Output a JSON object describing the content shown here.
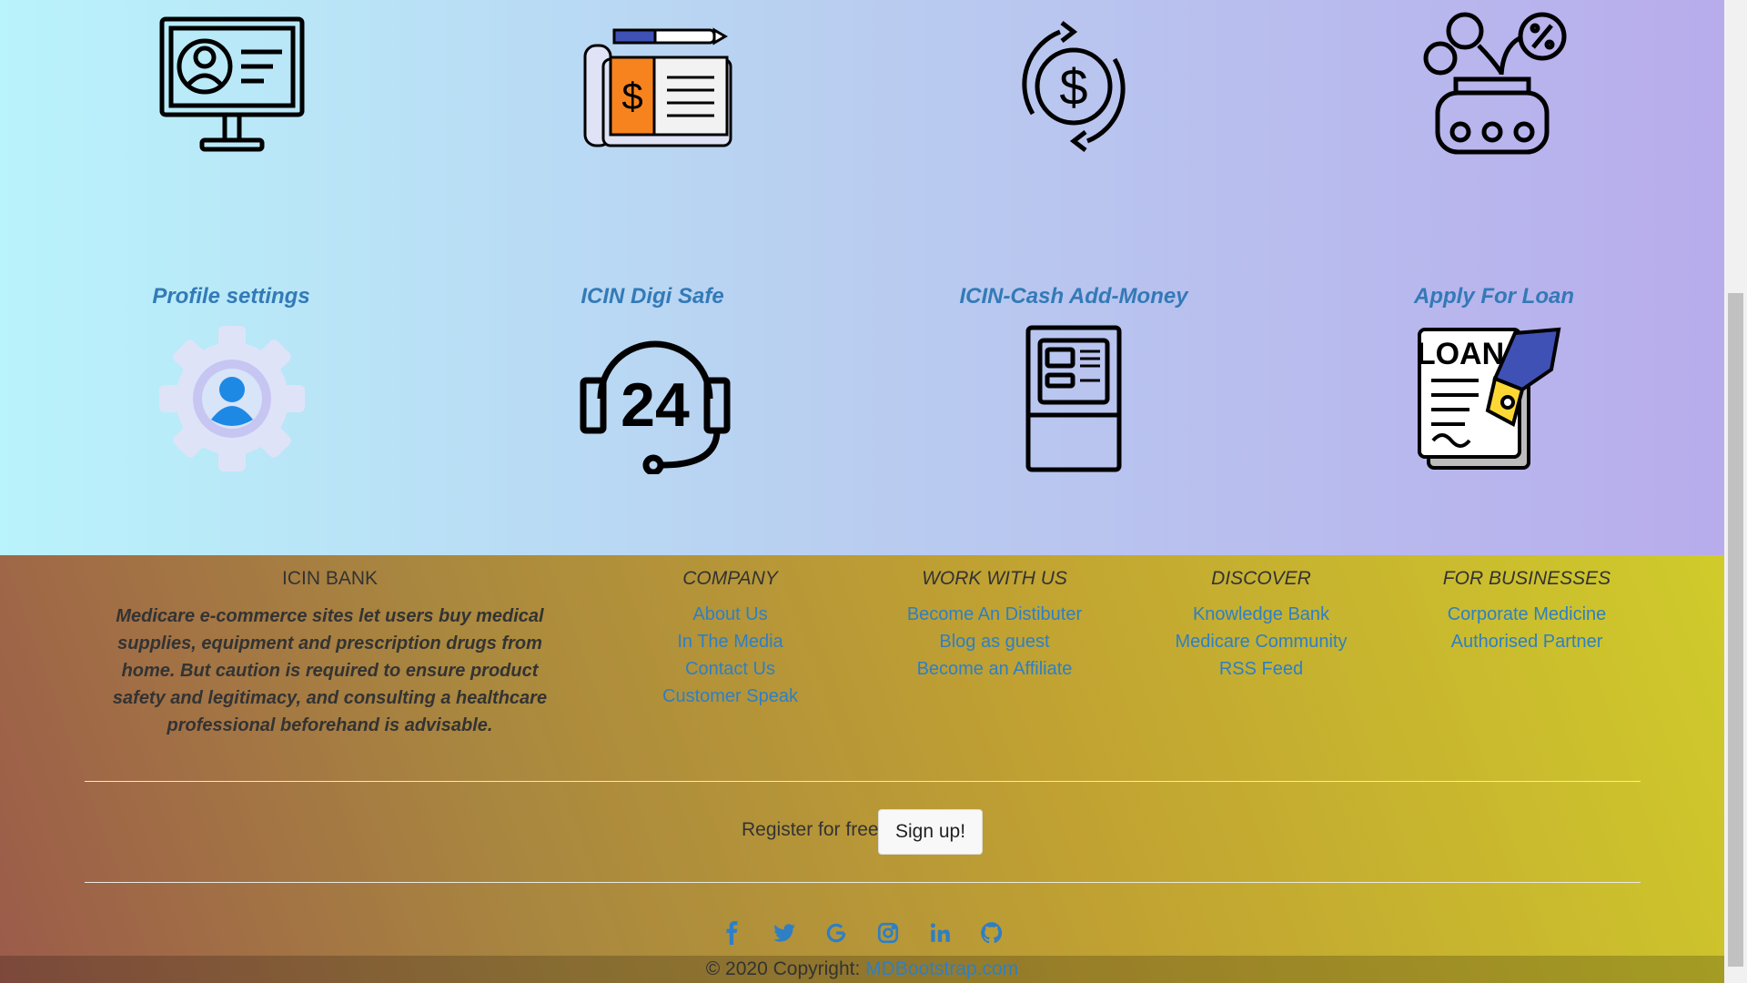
{
  "tiles_row2": [
    {
      "title": "Profile settings",
      "icon": "profile-gear-icon"
    },
    {
      "title": "ICIN Digi Safe",
      "icon": "headset-24-icon"
    },
    {
      "title": "ICIN-Cash Add-Money",
      "icon": "atm-icon"
    },
    {
      "title": "Apply For Loan",
      "icon": "loan-document-icon"
    }
  ],
  "tiles_row1_icons": [
    "monitor-profile-icon",
    "newspaper-dollar-icon",
    "dollar-exchange-icon",
    "loan-machine-icon"
  ],
  "footer": {
    "brand": "ICIN BANK",
    "description": "Medicare e-commerce sites let users buy medical supplies, equipment and prescription drugs from home. But caution is required to ensure product safety and legitimacy, and consulting a healthcare professional beforehand is advisable.",
    "columns": [
      {
        "heading": "COMPANY",
        "links": [
          "About Us",
          "In The Media",
          "Contact Us",
          "Customer Speak"
        ]
      },
      {
        "heading": "WORK WITH US",
        "links": [
          "Become An Distibuter",
          "Blog as guest",
          "Become an Affiliate"
        ]
      },
      {
        "heading": "DISCOVER",
        "links": [
          "Knowledge Bank",
          "Medicare Community",
          "RSS Feed"
        ]
      },
      {
        "heading": "FOR BUSINESSES",
        "links": [
          "Corporate Medicine",
          "Authorised Partner"
        ]
      }
    ],
    "register_text": "Register for free",
    "signup_label": "Sign up!",
    "social_icons": [
      "facebook-icon",
      "twitter-icon",
      "google-icon",
      "instagram-icon",
      "linkedin-icon",
      "github-icon"
    ],
    "copyright_text": "© 2020 Copyright:",
    "copyright_link": "MDBootstrap.com"
  },
  "colors": {
    "link": "#2e7fc4",
    "title": "#337ab7",
    "accent_orange": "#f7831e"
  }
}
